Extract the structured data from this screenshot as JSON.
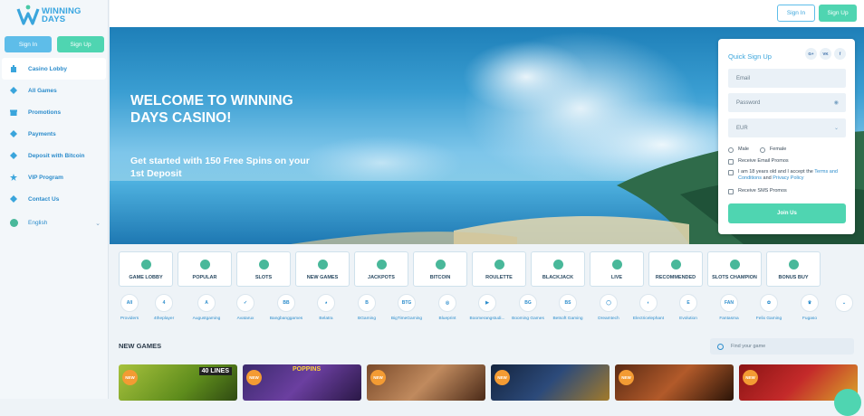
{
  "brand": {
    "line1": "WINNING",
    "line2": "DAYS"
  },
  "auth": {
    "signin": "Sign In",
    "signup": "Sign Up"
  },
  "nav": [
    {
      "label": "Casino Lobby",
      "icon": "casino-icon"
    },
    {
      "label": "All Games",
      "icon": "cards-icon"
    },
    {
      "label": "Promotions",
      "icon": "gift-icon"
    },
    {
      "label": "Payments",
      "icon": "wallet-icon"
    },
    {
      "label": "Deposit with Bitcoin",
      "icon": "bitcoin-icon"
    },
    {
      "label": "VIP Program",
      "icon": "star-icon"
    },
    {
      "label": "Contact Us",
      "icon": "chat-icon"
    }
  ],
  "language": {
    "label": "English"
  },
  "hero": {
    "headline": "WELCOME TO WINNING DAYS CASINO!",
    "subline": "Get started with 150 Free Spins on your 1st Deposit"
  },
  "quick_signup": {
    "title": "Quick Sign Up",
    "social": [
      "G+",
      "VK",
      "f"
    ],
    "email_placeholder": "Email",
    "password_placeholder": "Password",
    "currency": "EUR",
    "gender_male": "Male",
    "gender_female": "Female",
    "receive_email": "Receive Email Promos",
    "age_text_1": "I am 18 years old and I accept the ",
    "terms": "Terms and Conditions",
    "and": " and ",
    "privacy": "Privacy Policy",
    "receive_sms": "Receive SMS Promos",
    "join": "Join Us"
  },
  "categories": [
    "GAME LOBBY",
    "POPULAR",
    "SLOTS",
    "NEW GAMES",
    "JACKPOTS",
    "BITCOIN",
    "ROULETTE",
    "BLACKJACK",
    "LIVE",
    "RECOMMENDED",
    "SLOTS CHAMPION",
    "BONUS BUY"
  ],
  "providers": [
    {
      "label": "Providers",
      "logo": "All"
    },
    {
      "label": "4theplayer",
      "logo": "4"
    },
    {
      "label": "Augustgaming",
      "logo": "A"
    },
    {
      "label": "Avatarux",
      "logo": "✓"
    },
    {
      "label": "Bangbanggames",
      "logo": "BB"
    },
    {
      "label": "Belatra",
      "logo": "◕"
    },
    {
      "label": "BGaming",
      "logo": "B"
    },
    {
      "label": "BigTimeGaming",
      "logo": "BTG"
    },
    {
      "label": "Blueprint",
      "logo": "◎"
    },
    {
      "label": "Boomerangstudi...",
      "logo": "▶"
    },
    {
      "label": "Booming Games",
      "logo": "BG"
    },
    {
      "label": "Betsoft Gaming",
      "logo": "BS"
    },
    {
      "label": "Dreamtech",
      "logo": "◯"
    },
    {
      "label": "Electricelephant",
      "logo": "◐"
    },
    {
      "label": "Evolution",
      "logo": "E"
    },
    {
      "label": "Fantasma",
      "logo": "FAN"
    },
    {
      "label": "Felix Gaming",
      "logo": "✿"
    },
    {
      "label": "Fugaso",
      "logo": "♛"
    }
  ],
  "games_section": {
    "title": "NEW GAMES",
    "search_placeholder": "Find your game"
  },
  "game_tiles": [
    {
      "badge": "NEW",
      "text": "40 LINES"
    },
    {
      "badge": "NEW",
      "text": "POPPINS"
    },
    {
      "badge": "NEW",
      "text": ""
    },
    {
      "badge": "NEW",
      "text": ""
    },
    {
      "badge": "NEW",
      "text": ""
    },
    {
      "badge": "NEW",
      "text": ""
    }
  ]
}
